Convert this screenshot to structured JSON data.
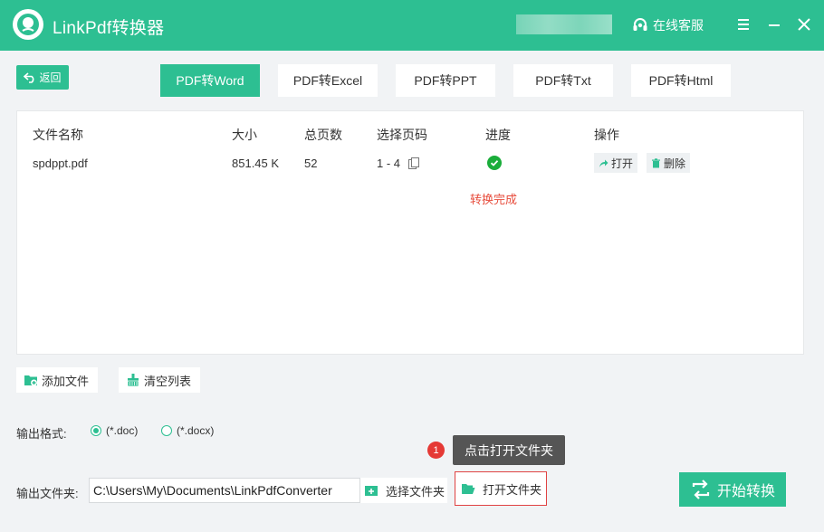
{
  "app": {
    "title": "LinkPdf转换器"
  },
  "header": {
    "support_label": "在线客服"
  },
  "back_label": "返回",
  "tabs": [
    {
      "label": "PDF转Word",
      "active": true
    },
    {
      "label": "PDF转Excel",
      "active": false
    },
    {
      "label": "PDF转PPT",
      "active": false
    },
    {
      "label": "PDF转Txt",
      "active": false
    },
    {
      "label": "PDF转Html",
      "active": false
    }
  ],
  "table": {
    "columns": [
      "文件名称",
      "大小",
      "总页数",
      "选择页码",
      "进度",
      "操作"
    ],
    "rows": [
      {
        "name": "spdppt.pdf",
        "size": "851.45 K",
        "pages": "52",
        "page_range": "1 - 4",
        "status_text": "转换完成",
        "open_label": "打开",
        "delete_label": "删除"
      }
    ]
  },
  "actions": {
    "add_file": "添加文件",
    "clear_list": "清空列表"
  },
  "output": {
    "format_label": "输出格式:",
    "format_options": [
      {
        "label": "(*.doc)",
        "selected": true
      },
      {
        "label": "(*.docx)",
        "selected": false
      }
    ],
    "folder_label": "输出文件夹:",
    "folder_path": "C:\\Users\\My\\Documents\\LinkPdfConverter",
    "select_folder": "选择文件夹",
    "open_folder": "打开文件夹"
  },
  "tooltip": {
    "step": "1",
    "text": "点击打开文件夹"
  },
  "start_label": "开始转换",
  "colors": {
    "accent": "#2dbf92",
    "error": "#e74c3c",
    "highlight_border": "#e04343"
  }
}
